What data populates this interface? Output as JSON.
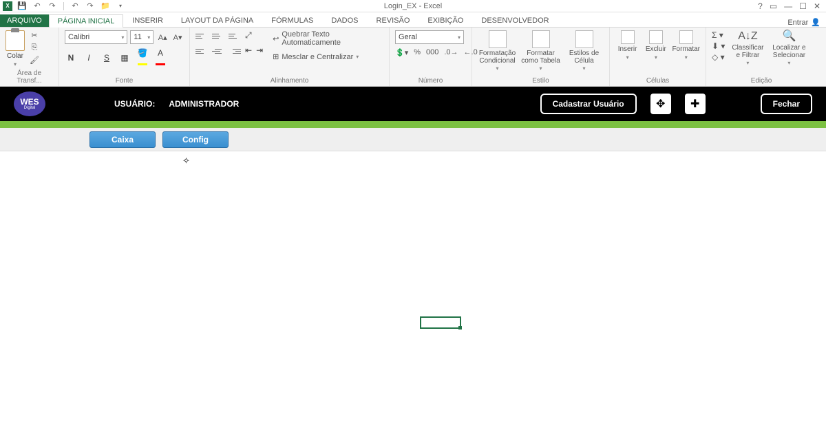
{
  "title": "Login_EX - Excel",
  "signin": "Entrar",
  "tabs": {
    "file": "ARQUIVO",
    "home": "PÁGINA INICIAL",
    "insert": "INSERIR",
    "layout": "LAYOUT DA PÁGINA",
    "formulas": "FÓRMULAS",
    "data": "DADOS",
    "review": "REVISÃO",
    "view": "EXIBIÇÃO",
    "dev": "DESENVOLVEDOR"
  },
  "ribbon": {
    "clipboard": {
      "paste": "Colar",
      "label": "Área de Transf..."
    },
    "font": {
      "name": "Calibri",
      "size": "11",
      "label": "Fonte"
    },
    "align": {
      "wrap": "Quebrar Texto Automaticamente",
      "merge": "Mesclar e Centralizar",
      "label": "Alinhamento"
    },
    "number": {
      "format": "Geral",
      "label": "Número"
    },
    "styles": {
      "cond": "Formatação Condicional",
      "table": "Formatar como Tabela",
      "cell": "Estilos de Célula",
      "label": "Estilo"
    },
    "cells": {
      "insert": "Inserir",
      "delete": "Excluir",
      "format": "Formatar",
      "label": "Células"
    },
    "editing": {
      "sort": "Classificar e Filtrar",
      "find": "Localizar e Selecionar",
      "label": "Edição"
    }
  },
  "app": {
    "logo_top": "WES",
    "logo_bottom": "Digital",
    "user_label": "USUÁRIO:",
    "user_name": "ADMINISTRADOR",
    "register": "Cadastrar Usuário",
    "close": "Fechar"
  },
  "buttons": {
    "caixa": "Caixa",
    "config": "Config"
  }
}
